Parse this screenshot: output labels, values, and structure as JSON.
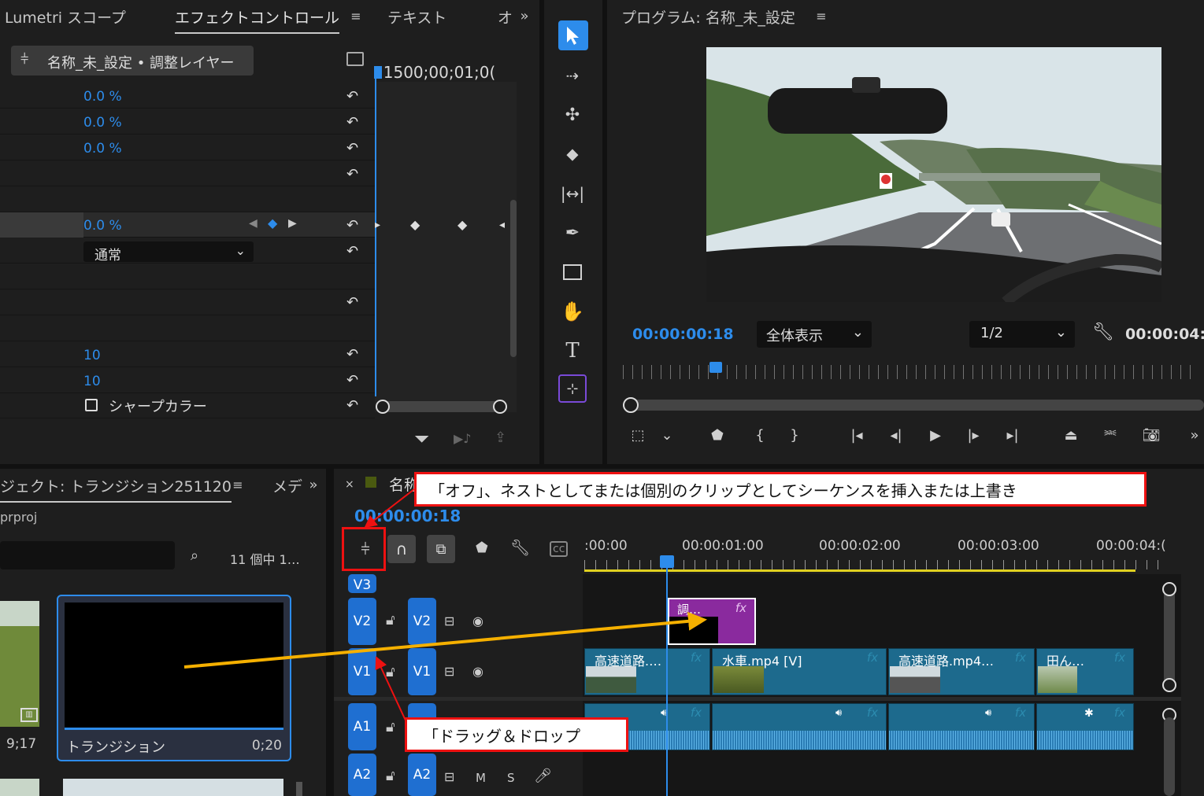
{
  "effects_panel": {
    "tabs": [
      "Lumetri スコープ",
      "エフェクトコントロール",
      "テキスト",
      "オ"
    ],
    "clip_label": "名称_未_設定 • 調整レイヤー",
    "timecode": ":1500;00;01;0(",
    "values": [
      "0.0 %",
      "0.0 %",
      "0.0 %",
      "0.0 %",
      "10",
      "10"
    ],
    "blend_mode": "通常",
    "checkbox_label": "シャープカラー"
  },
  "program_monitor": {
    "title": "プログラム: 名称_未_設定",
    "timecode": "00:00:00:18",
    "zoom": "全体表示",
    "resolution": "1/2",
    "duration": "00:00:04:0"
  },
  "project_panel": {
    "title": "ジェクト: トランジション251120",
    "tab2": "メデ",
    "file": "prproj",
    "count": "11 個中 1…",
    "item_name": "トランジション",
    "item_duration": "0;20",
    "left_duration": "9;17"
  },
  "timeline": {
    "tab_name": "名称",
    "timecode": "00:00:00:18",
    "ruler": [
      ":00:00",
      "00:00:01:00",
      "00:00:02:00",
      "00:00:03:00",
      "00:00:04:("
    ],
    "tracks": [
      "V3",
      "V2",
      "V1",
      "A1",
      "A2"
    ],
    "audio_ms": [
      "M",
      "S"
    ],
    "adjustment_clip": "調…",
    "video_clips": [
      "高速道路.…",
      "水車.mp4 [V]",
      "高速道路.mp4…",
      "田ん…"
    ],
    "fx": "fx"
  },
  "annotations": {
    "callout1": "「オフ」、ネストとしてまたは個別のクリップとしてシーケンスを挿入または上書き",
    "callout2": "「ドラッグ＆ドロップ"
  }
}
